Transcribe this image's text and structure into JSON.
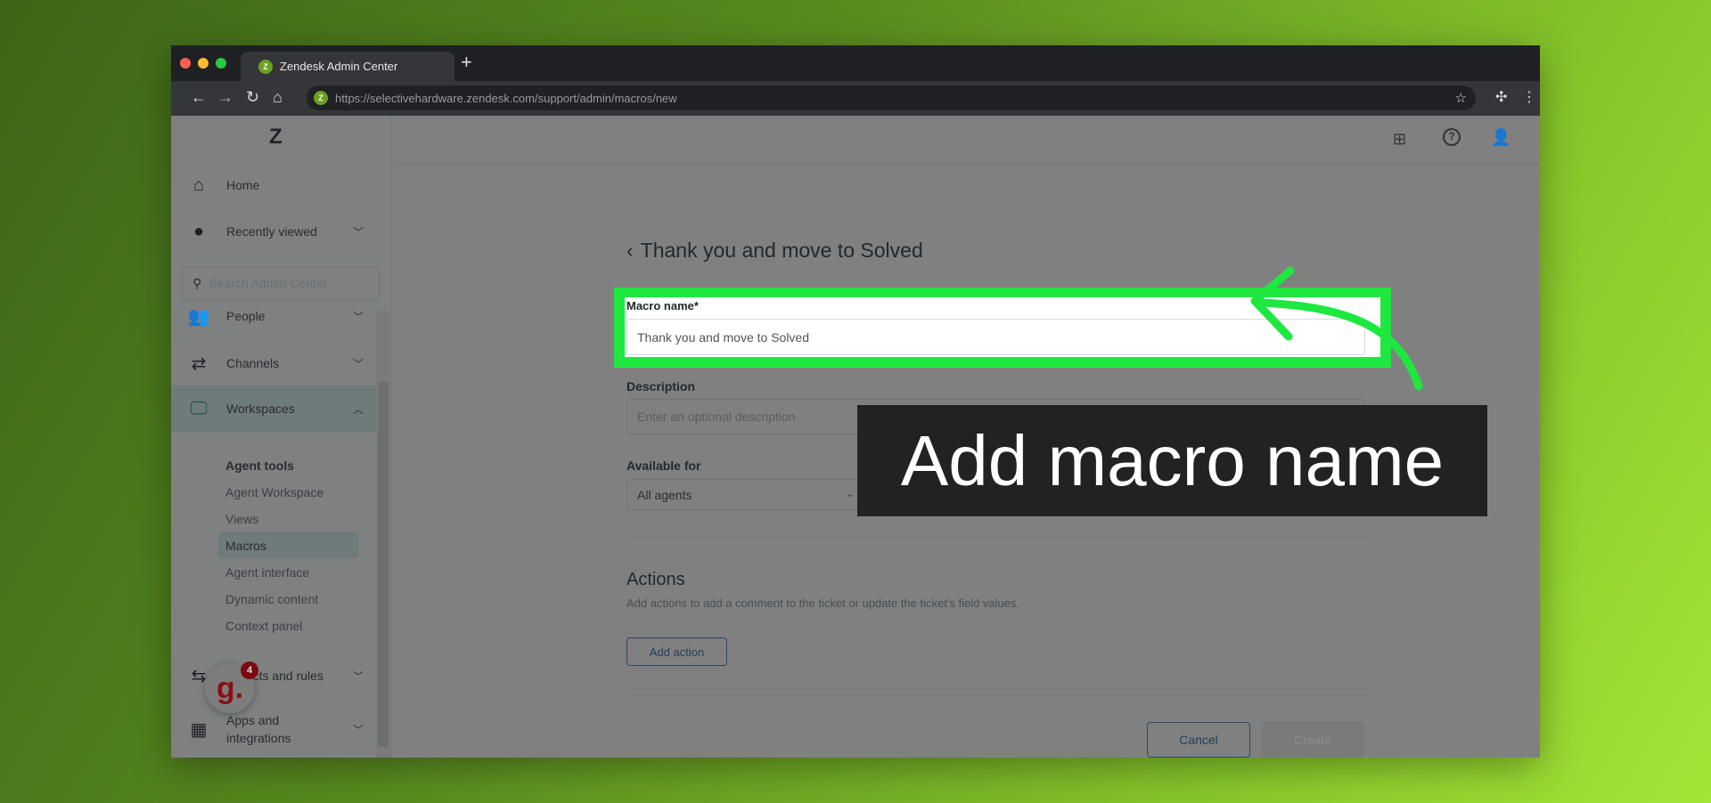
{
  "browser": {
    "tab_title": "Zendesk Admin Center",
    "url": "https://selectivehardware.zendesk.com/support/admin/macros/new"
  },
  "sidebar": {
    "home": "Home",
    "recently_viewed": "Recently viewed",
    "search_placeholder": "Search Admin Center",
    "people": "People",
    "channels": "Channels",
    "workspaces": "Workspaces",
    "group_title": "Agent tools",
    "sub_items": [
      "Agent Workspace",
      "Views",
      "Macros",
      "Agent interface",
      "Dynamic content",
      "Context panel"
    ],
    "objects_rules": "Objects and rules",
    "apps_line1": "Apps and",
    "apps_line2": "integrations"
  },
  "badge": {
    "letter": "g.",
    "count": "4"
  },
  "page": {
    "title": "Thank you and move to Solved",
    "macro_name_label": "Macro name*",
    "macro_name_value": "Thank you and move to Solved",
    "description_label": "Description",
    "description_placeholder": "Enter an optional description",
    "available_label": "Available for",
    "available_value": "All agents",
    "actions_title": "Actions",
    "actions_subtitle": "Add actions to add a comment to the ticket or update the ticket's field values.",
    "add_action": "Add action",
    "cancel": "Cancel",
    "create": "Create"
  },
  "annotation": {
    "text": "Add macro name",
    "highlight_color": "#1ee83f"
  }
}
